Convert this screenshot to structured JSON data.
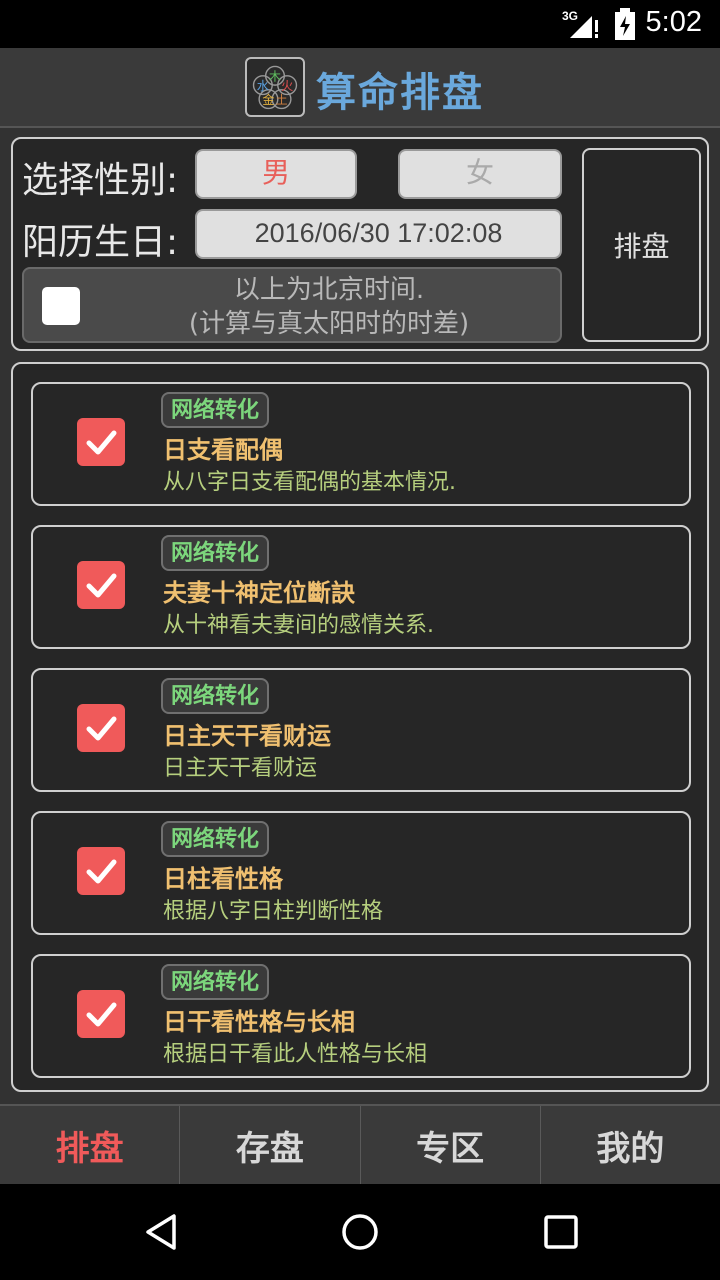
{
  "status": {
    "time": "5:02",
    "network": "3G"
  },
  "header": {
    "title": "算命排盘",
    "logo_chars": [
      "木",
      "火",
      "水",
      "金",
      "土"
    ]
  },
  "form": {
    "gender_label": "选择性别:",
    "male": "男",
    "female": "女",
    "birthday_label": "阳历生日:",
    "birthday_value": "2016/06/30 17:02:08",
    "tz_line1": "以上为北京时间.",
    "tz_line2": "(计算与真太阳时的时差)",
    "chart_button": "排盘"
  },
  "items": [
    {
      "tag": "网络转化",
      "title": "日支看配偶",
      "desc": "从八字日支看配偶的基本情况."
    },
    {
      "tag": "网络转化",
      "title": "夫妻十神定位斷訣",
      "desc": "从十神看夫妻间的感情关系."
    },
    {
      "tag": "网络转化",
      "title": "日主天干看财运",
      "desc": "日主天干看财运"
    },
    {
      "tag": "网络转化",
      "title": "日柱看性格",
      "desc": "根据八字日柱判断性格"
    },
    {
      "tag": "网络转化",
      "title": "日干看性格与长相",
      "desc": "根据日干看此人性格与长相"
    }
  ],
  "tabs": [
    {
      "label": "排盘"
    },
    {
      "label": "存盘"
    },
    {
      "label": "专区"
    },
    {
      "label": "我的"
    }
  ],
  "colors": {
    "accent": "#f05a5a",
    "title_blue": "#6aa8dc",
    "tag_green": "#7cd67c"
  }
}
